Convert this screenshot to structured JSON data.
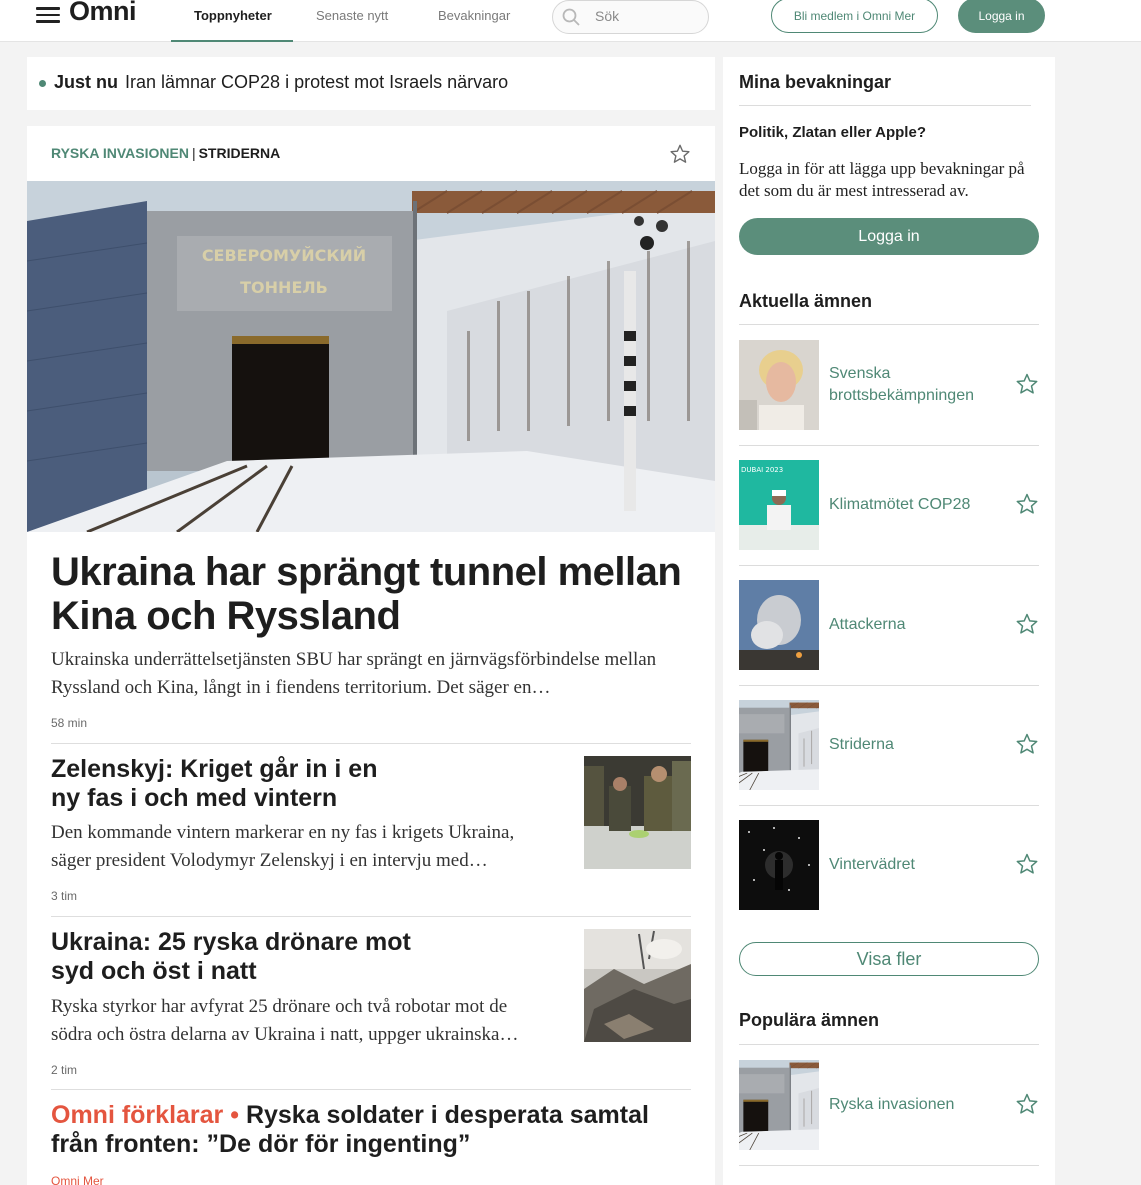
{
  "header": {
    "logo": "Omni",
    "tabs": [
      "Toppnyheter",
      "Senaste nytt",
      "Bevakningar"
    ],
    "search_placeholder": "Sök",
    "member_button": "Bli medlem i Omni Mer",
    "login_button": "Logga in"
  },
  "justnu": {
    "label": "Just nu",
    "headline": "Iran lämnar COP28 i protest mot Israels närvaro"
  },
  "main": {
    "kicker_topic": "RYSKA INVASIONEN",
    "kicker_separator": "|",
    "kicker_sub": "STRIDERNA",
    "hero_sign_line1": "СЕВЕРОМУЙСКИЙ",
    "hero_sign_line2": "ТОННЕЛЬ",
    "hero_title": "Ukraina har sprängt tunnel mellan Kina och Ryssland",
    "hero_lede": "Ukrainska underrättelsetjänsten SBU har sprängt en järnvägsförbindelse mellan Ryssland och Kina, långt in i fiendens territorium. Det säger en…",
    "hero_time": "58 min",
    "articles": [
      {
        "title": "Zelenskyj: Kriget går in i en ny fas i och med vintern",
        "lede": "Den kommande vintern markerar en ny fas i krigets Ukraina, säger president Volodymyr Zelenskyj i en intervju med…",
        "time": "3 tim"
      },
      {
        "title": "Ukraina: 25 ryska drönare mot syd och öst i natt",
        "lede": "Ryska styrkor har avfyrat 25 drönare och två robotar mot de södra och östra delarna av Ukraina i natt, uppger ukrainska…",
        "time": "2 tim"
      }
    ],
    "explainer": {
      "kicker": "Omni förklarar •",
      "title": "Ryska soldater i desperata samtal från fronten: ”De dör för ingenting”",
      "source": "Omni Mer"
    }
  },
  "sidebar": {
    "watch_title": "Mina bevakningar",
    "watch_question": "Politik, Zlatan eller Apple?",
    "watch_text": "Logga in för att lägga upp bevakningar på det som du är mest intresserad av.",
    "login_button": "Logga in",
    "current_title": "Aktuella ämnen",
    "current_topics": [
      {
        "name": "Svenska brottsbekämpningen",
        "icon": "star-icon"
      },
      {
        "name": "Klimatmötet COP28",
        "icon": "star-icon"
      },
      {
        "name": "Attackerna",
        "icon": "star-icon"
      },
      {
        "name": "Striderna",
        "icon": "star-icon"
      },
      {
        "name": "Vintervädret",
        "icon": "star-icon"
      }
    ],
    "cop_banner": "DUBAI 2023",
    "more_button": "Visa fler",
    "popular_title": "Populära ämnen",
    "popular_topics": [
      {
        "name": "Ryska invasionen",
        "icon": "star-icon"
      }
    ]
  },
  "colors": {
    "accent_green": "#4f8875",
    "button_green": "#5b8e7b",
    "explainer_red": "#e4553f"
  }
}
